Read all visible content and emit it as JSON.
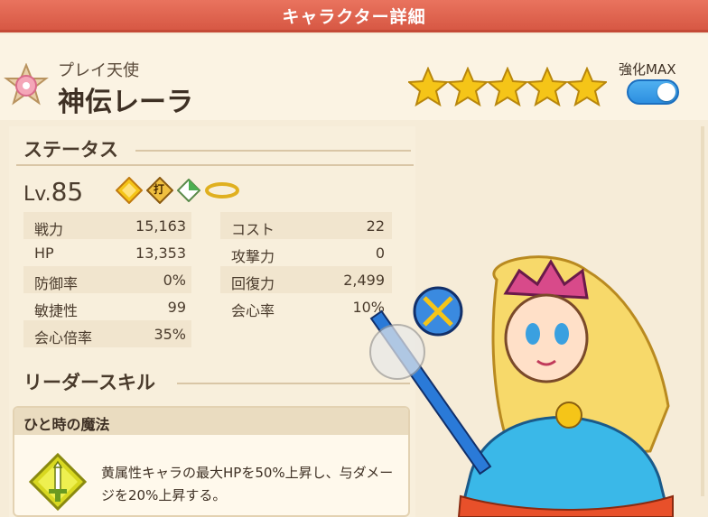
{
  "screen": {
    "title": "キャラクター詳細"
  },
  "header": {
    "subtitle": "プレイ天使",
    "name": "神伝レーラ",
    "stars": 5,
    "enhance_label": "強化MAX",
    "enhance_on": true,
    "emblem_icon": "pink-flower-emblem-icon"
  },
  "status": {
    "section_title": "ステータス",
    "level_prefix": "Lv.",
    "level": "85",
    "attribute_icons": [
      "yellow-diamond-icon",
      "strike-type-icon",
      "green-white-diamond-icon",
      "gold-ring-icon"
    ],
    "attribute_text": "打",
    "left": [
      {
        "label": "戦力",
        "value": "15,163"
      },
      {
        "label": "HP",
        "value": "13,353"
      },
      {
        "label": "防御率",
        "value": "0%"
      },
      {
        "label": "敏捷性",
        "value": "99"
      },
      {
        "label": "会心倍率",
        "value": "35%"
      }
    ],
    "right": [
      {
        "label": "コスト",
        "value": "22"
      },
      {
        "label": "攻撃力",
        "value": "0"
      },
      {
        "label": "回復力",
        "value": "2,499"
      },
      {
        "label": "会心率",
        "value": "10%"
      }
    ]
  },
  "leader_skill": {
    "section_title": "リーダースキル",
    "name": "ひと時の魔法",
    "description": "黄属性キャラの最大HPを50%上昇し、与ダメージを20%上昇する。",
    "icon": "sword-skill-icon"
  },
  "colors": {
    "title_bar": "#d75844",
    "toggle": "#2d8fe0",
    "star": "#f5c518"
  }
}
